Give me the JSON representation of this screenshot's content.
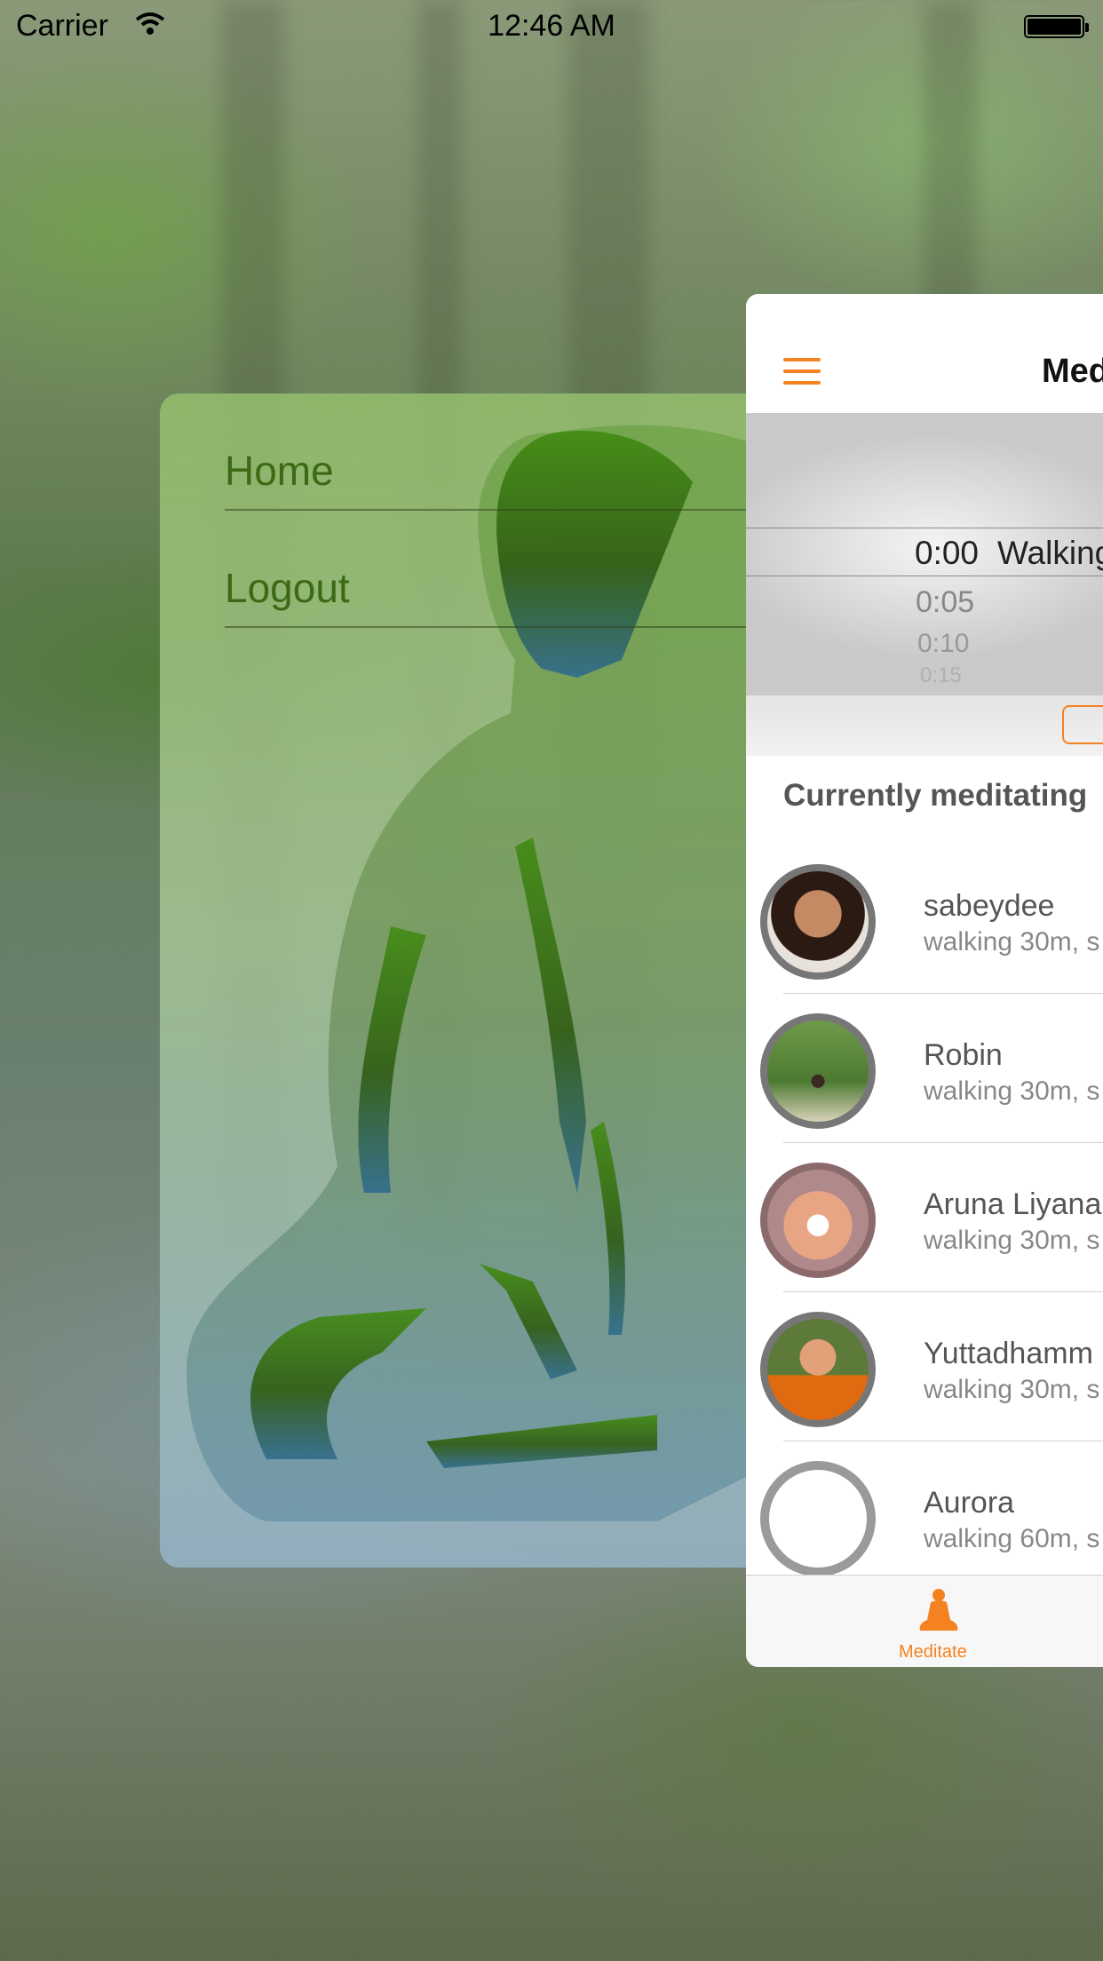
{
  "status_bar": {
    "carrier": "Carrier",
    "time": "12:46 AM"
  },
  "side_menu": {
    "items": [
      {
        "label": "Home"
      },
      {
        "label": "Logout"
      }
    ]
  },
  "main": {
    "nav_title": "Med",
    "picker": {
      "selected_time": "0:00",
      "selected_type": "Walking",
      "options": [
        "0:05",
        "0:10",
        "0:15"
      ]
    },
    "section_title": "Currently meditating",
    "meditators": [
      {
        "name": "sabeydee",
        "detail": "walking 30m, s"
      },
      {
        "name": "Robin",
        "detail": "walking 30m, s"
      },
      {
        "name": "Aruna Liyana",
        "detail": "walking 30m, s"
      },
      {
        "name": "Yuttadhamm",
        "detail": "walking 30m, s"
      },
      {
        "name": "Aurora",
        "detail": "walking 60m, s"
      }
    ]
  },
  "tab_bar": {
    "tabs": [
      {
        "label": "Meditate",
        "icon": "buddha-icon",
        "active": true
      }
    ]
  },
  "colors": {
    "accent": "#f58220",
    "menu_text": "#3c6a14"
  }
}
